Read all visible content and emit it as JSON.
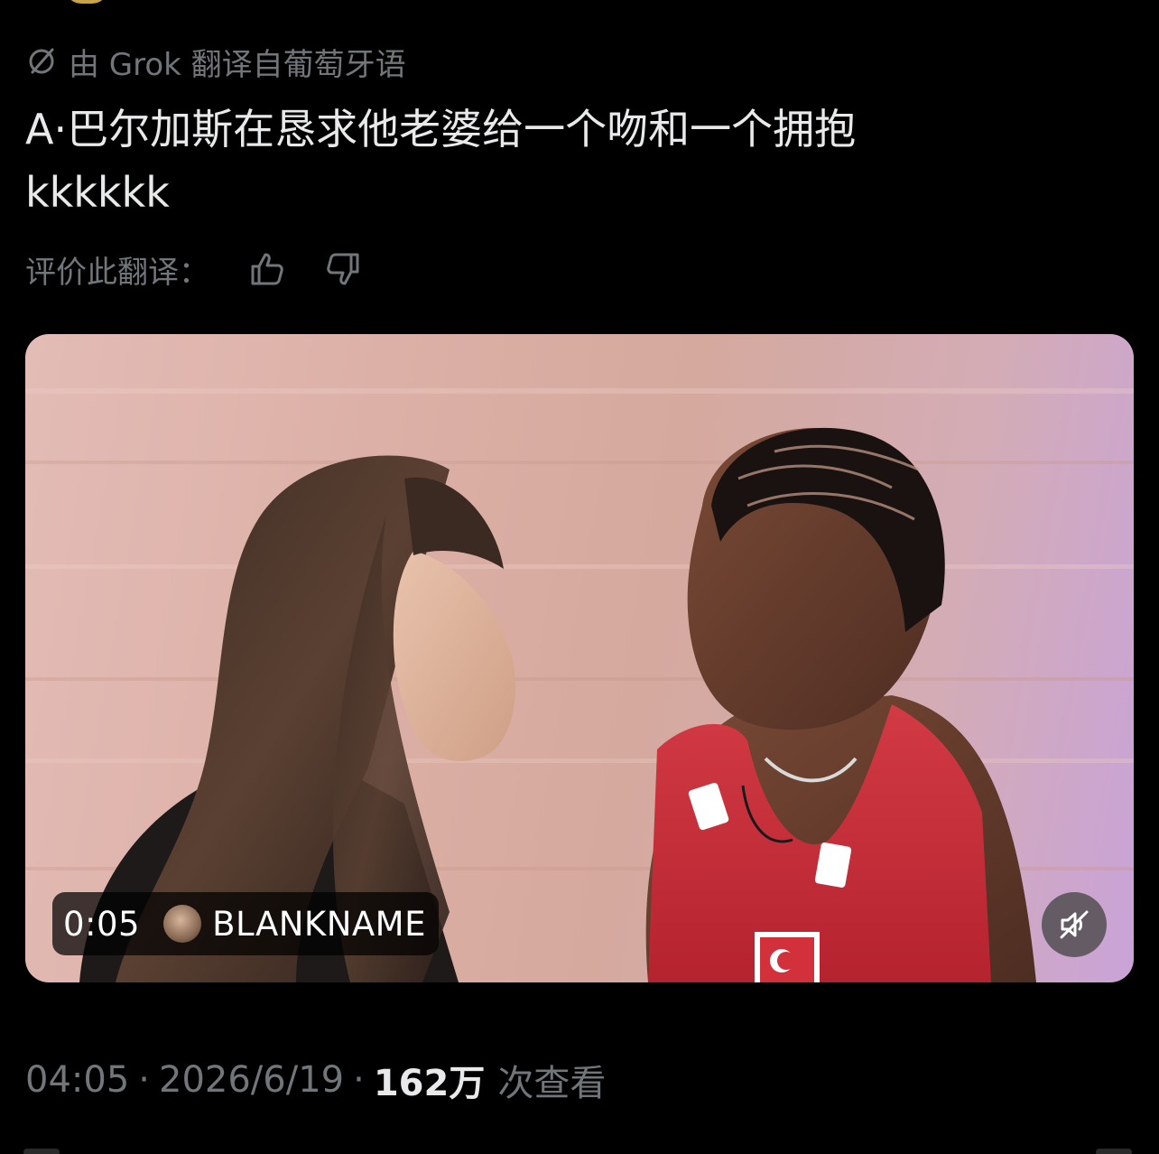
{
  "translation_notice": {
    "icon": "translate-icon",
    "text": "由 Grok 翻译自葡萄牙语"
  },
  "tweet": {
    "text_line1": "A·巴尔加斯在恳求他老婆给一个吻和一个拥抱",
    "text_line2": "kkkkkk"
  },
  "rate_translation": {
    "label": "评价此翻译：",
    "like_icon": "thumbs-up-icon",
    "dislike_icon": "thumbs-down-icon"
  },
  "video": {
    "time": "0:05",
    "creator": "BLANKNAME",
    "mute_icon": "speaker-muted-icon"
  },
  "meta": {
    "time": "04:05",
    "separator": "·",
    "date": "2026/6/19",
    "views": "162万",
    "views_label": "次查看"
  },
  "colors": {
    "background": "#000000",
    "primary_text": "#e7e9ea",
    "secondary_text": "#71767b",
    "jersey_red": "#c62a36"
  }
}
